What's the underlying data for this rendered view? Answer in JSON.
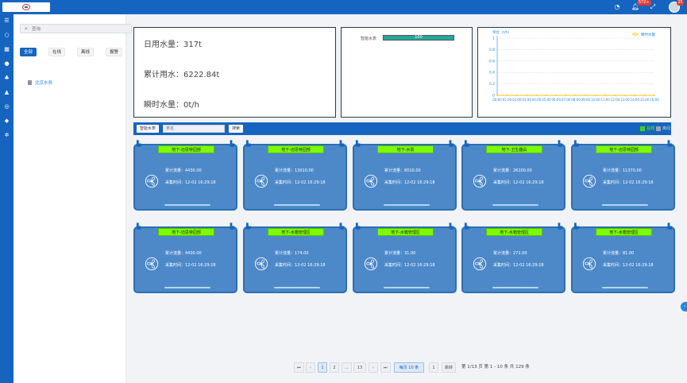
{
  "header": {
    "notification_count": "572+",
    "avatar_count": "25"
  },
  "tree": {
    "search_placeholder": "查询",
    "filters": [
      "全部",
      "在线",
      "离线",
      "报警"
    ],
    "node": "北京水务"
  },
  "summary": {
    "daily_usage": "日用水量：317t",
    "total_usage": "累计用水：6222.84t",
    "instant_usage": "瞬时水量：0t/h"
  },
  "progress": {
    "label": "智能水表",
    "value_text": "100",
    "value": 1.0
  },
  "chart_data": {
    "type": "line",
    "ylabel": "单位（t/h）",
    "legend": "瞬时水量",
    "y_ticks": [
      "1",
      "0.8",
      "0.6",
      "0.4",
      "0.2",
      "0"
    ],
    "ylim": [
      0,
      1
    ],
    "x": [
      "00:00",
      "01:00",
      "02:00",
      "03:00",
      "04:00",
      "05:00",
      "06:00",
      "07:00",
      "08:00",
      "09:00",
      "10:00",
      "11:00",
      "12:00",
      "13:00",
      "14:00",
      "15:00",
      "16:00"
    ],
    "series": [
      {
        "name": "瞬时水量",
        "values": [
          0,
          0,
          0,
          0,
          0,
          0,
          0,
          0,
          0,
          0,
          0,
          0,
          0,
          0,
          0,
          0,
          0
        ]
      }
    ],
    "colors": {
      "line": "#ffc107",
      "axis": "#1e88e5"
    }
  },
  "query": {
    "type_label": "智能水表",
    "input_placeholder": "表名",
    "search_label": "搜索",
    "legend_online": "在线",
    "legend_offline": "离线"
  },
  "cards": [
    {
      "name": "地下-迈思特园部",
      "flow": "累计流量：4430.00",
      "time": "采集时间：12-02 16:29:18"
    },
    {
      "name": "地下-迈思特园部",
      "flow": "累计流量：13010.00",
      "time": "采集时间：12-02 16:29:18"
    },
    {
      "name": "地下-水泵",
      "flow": "累计流量：8010.00",
      "time": "采集时间：12-02 16:29:18"
    },
    {
      "name": "地下-卫生器具",
      "flow": "累计流量：26100.00",
      "time": "采集时间：12-02 16:29:18"
    },
    {
      "name": "地下-迈思特园部",
      "flow": "累计流量：11370.00",
      "time": "采集时间：12-02 16:29:18"
    },
    {
      "name": "地下-迈思特园部",
      "flow": "累计流量：4430.00",
      "time": "采集时间：12-02 16:29:18"
    },
    {
      "name": "地下-水箱管理区",
      "flow": "累计流量：174.00",
      "time": "采集时间：12-02 16:29:18"
    },
    {
      "name": "地下-水箱管理区",
      "flow": "累计流量：31.00",
      "time": "采集时间：12-02 16:29:18"
    },
    {
      "name": "地下-水箱管理区",
      "flow": "累计流量：271.00",
      "time": "采集时间：12-02 16:29:18"
    },
    {
      "name": "地下-水箱管理区",
      "flow": "累计流量：81.00",
      "time": "采集时间：12-02 16:29:18"
    }
  ],
  "pagination": {
    "first": "⏮",
    "prev": "‹",
    "pages": [
      "1",
      "2",
      "…",
      "13"
    ],
    "next": "›",
    "last": "⏭",
    "page_size": "每页 10 条",
    "goto_value": "1",
    "goto_label": "跳转",
    "summary": "第 1/13 页  第 1 - 10 条 共 129 条"
  }
}
